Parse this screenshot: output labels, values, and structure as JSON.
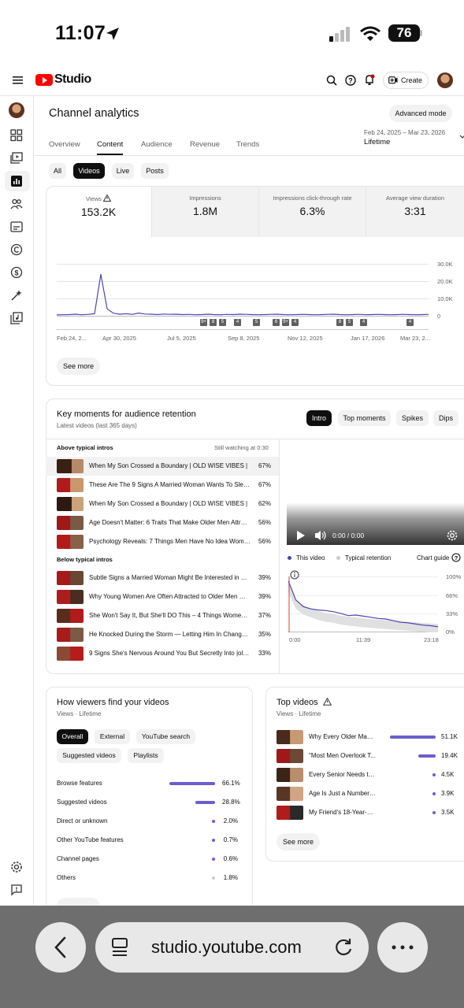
{
  "status": {
    "time": "11:07",
    "battery": "76"
  },
  "header": {
    "brand": "Studio",
    "create_label": "Create"
  },
  "page": {
    "title": "Channel analytics",
    "advanced_mode": "Advanced mode",
    "tabs": [
      "Overview",
      "Content",
      "Audience",
      "Revenue",
      "Trends"
    ],
    "active_tab": "Content",
    "date_range": "Feb 24, 2025 – Mar 23, 2026",
    "period": "Lifetime"
  },
  "filters": {
    "chips": [
      "All",
      "Videos",
      "Live",
      "Posts"
    ],
    "active": "Videos"
  },
  "metrics": [
    {
      "label": "Views",
      "value": "153.2K"
    },
    {
      "label": "Impressions",
      "value": "1.8M"
    },
    {
      "label": "Impressions click-through rate",
      "value": "6.3%"
    },
    {
      "label": "Average view duration",
      "value": "3:31"
    }
  ],
  "chart_data": [
    {
      "type": "line",
      "series": [
        {
          "values": [
            500,
            600,
            700,
            900,
            600,
            800,
            1200,
            24000,
            4000,
            1500,
            900,
            1200,
            800,
            1600,
            1000,
            900,
            700,
            1000,
            800,
            900,
            700,
            800,
            600,
            700,
            900,
            700,
            600,
            800,
            700,
            900,
            800,
            700,
            600,
            700,
            800,
            900,
            700,
            600,
            700,
            800,
            700,
            600,
            700,
            800,
            900,
            700,
            600,
            700,
            800,
            600,
            700,
            800,
            700,
            600,
            700,
            800,
            700,
            600,
            700,
            800
          ]
        }
      ],
      "x_tick_labels": [
        "Feb 24, 2...",
        "Apr 30, 2025",
        "Jul 5, 2025",
        "Sep 8, 2025",
        "Nov 12, 2025",
        "Jan 17, 2026",
        "Mar 23, 2..."
      ],
      "y_tick_labels": [
        "30.0K",
        "20.0K",
        "10.0K",
        "0"
      ],
      "ylim": [
        0,
        30000
      ],
      "markers": [
        "9+",
        "8",
        "5",
        "4",
        "5",
        "6",
        "9+",
        "4",
        "8",
        "5",
        "4",
        "4"
      ],
      "grid": true
    },
    {
      "type": "line",
      "legend": [
        "This video",
        "Typical retention"
      ],
      "x_tick_labels": [
        "0:00",
        "11:39",
        "23:18"
      ],
      "y_tick_labels": [
        "100%",
        "66%",
        "33%",
        "0%"
      ],
      "ylim": [
        0,
        100
      ],
      "series": [
        {
          "name": "This video",
          "values": [
            92,
            58,
            46,
            42,
            40,
            39,
            37,
            34,
            30,
            31,
            29,
            27,
            25,
            24,
            21,
            18,
            17,
            15,
            13,
            12,
            10
          ]
        },
        {
          "name": "Typical retention",
          "values": [
            80,
            50,
            40,
            35,
            30,
            27,
            25,
            22,
            20,
            19,
            17,
            16,
            15,
            14,
            13,
            12,
            11,
            10,
            9,
            8,
            7
          ]
        }
      ]
    }
  ],
  "overview_chart": {
    "see_more": "See more"
  },
  "key_moments": {
    "title": "Key moments for audience retention",
    "subtitle": "Latest videos (last 365 days)",
    "buttons": [
      "Intro",
      "Top moments",
      "Spikes",
      "Dips"
    ],
    "active_button": "Intro",
    "above_label": "Above typical intros",
    "still_watching": "Still watching at 0:30",
    "above": [
      {
        "title": "When My Son Crossed a Boundary | OLD WISE VIBES |",
        "value": "67%"
      },
      {
        "title": "These Are The 9 Signs A Married Woman Wants To Slee...",
        "value": "67%"
      },
      {
        "title": "When My Son Crossed a Boundary | OLD WISE VIBES |",
        "value": "62%"
      },
      {
        "title": "Age Doesn't Matter: 6 Traits That Make Older Men Attrac...",
        "value": "56%"
      },
      {
        "title": "Psychology Reveals: 7 Things Men Have No Idea Women...",
        "value": "56%"
      }
    ],
    "below_label": "Below typical intros",
    "below": [
      {
        "title": "Subtle Signs a Married Woman Might Be Interested in Yo...",
        "value": "39%"
      },
      {
        "title": "Why Young Women Are Often Attracted to Older Men — T...",
        "value": "39%"
      },
      {
        "title": "She Won't Say It, But She'll DO This – 4 Things Women O...",
        "value": "37%"
      },
      {
        "title": "He Knocked During the Storm — Letting Him In Changed ...",
        "value": "35%"
      },
      {
        "title": "9 Signs She's Nervous Around You But Secretly Into |old ...",
        "value": "33%"
      }
    ],
    "player_time": "0:00 / 0:00",
    "legend_this": "This video",
    "legend_typical": "Typical retention",
    "chart_guide": "Chart guide"
  },
  "traffic": {
    "title": "How viewers find your videos",
    "subtitle": "Views · Lifetime",
    "chips": [
      "Overall",
      "External",
      "YouTube search",
      "Suggested videos",
      "Playlists"
    ],
    "active": "Overall",
    "rows": [
      {
        "label": "Browse features",
        "value": "66.1%",
        "fraction": 0.661
      },
      {
        "label": "Suggested videos",
        "value": "28.8%",
        "fraction": 0.288
      },
      {
        "label": "Direct or unknown",
        "value": "2.0%",
        "fraction": 0.02
      },
      {
        "label": "Other YouTube features",
        "value": "0.7%",
        "fraction": 0.007
      },
      {
        "label": "Channel pages",
        "value": "0.6%",
        "fraction": 0.006
      },
      {
        "label": "Others",
        "value": "1.8%",
        "fraction": 0.018
      }
    ]
  },
  "top_videos": {
    "title": "Top videos",
    "subtitle": "Views · Lifetime",
    "see_more": "See more",
    "rows": [
      {
        "title": "Why Every Older Man ...",
        "value": "51.1K",
        "fraction": 1.0
      },
      {
        "title": "\"Most Men Overlook T...",
        "value": "19.4K",
        "fraction": 0.38
      },
      {
        "title": "Every Senior Needs to ...",
        "value": "4.5K",
        "fraction": 0.088
      },
      {
        "title": "Age Is Just a Number: ...",
        "value": "3.9K",
        "fraction": 0.076
      },
      {
        "title": "My Friend's 18-Year-Ol...",
        "value": "3.5K",
        "fraction": 0.068
      }
    ]
  },
  "browser": {
    "url": "studio.youtube.com"
  }
}
